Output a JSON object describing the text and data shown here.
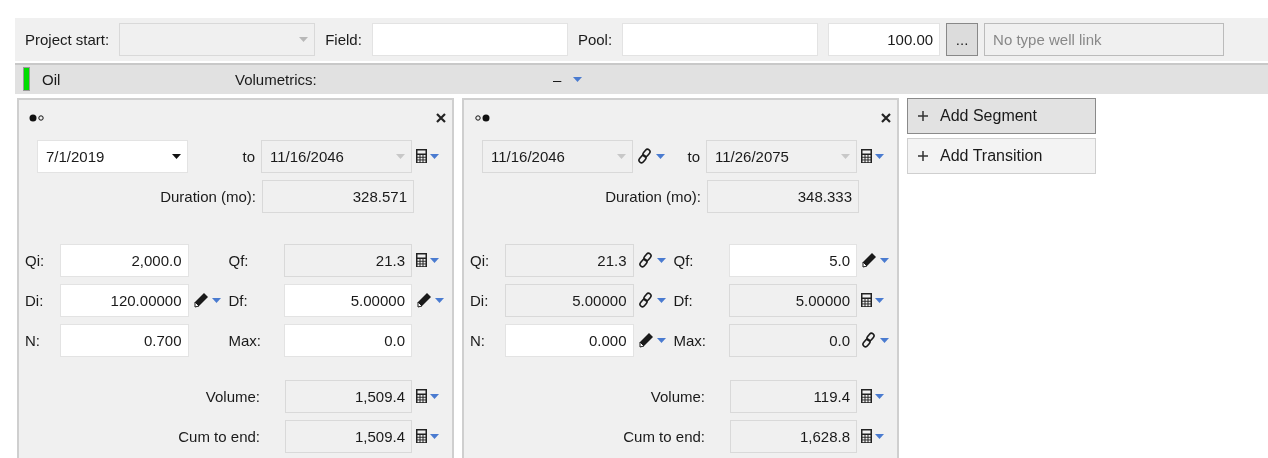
{
  "toolbar": [
    {
      "kind": "dropdown",
      "label": "Project start:",
      "disabled": true
    },
    {
      "kind": "text",
      "label": "Field:"
    },
    {
      "kind": "text",
      "label": "Pool:"
    },
    {
      "kind": "number",
      "value": "100.00"
    },
    {
      "kind": "browse",
      "label": "..."
    },
    {
      "kind": "readonly",
      "placeholder": "No type well link"
    }
  ],
  "stream": {
    "name": "Oil",
    "color": "#00dd00",
    "volumetrics_label": "Volumetrics:",
    "volumetrics_value": "–"
  },
  "segments": [
    {
      "dots": [
        {
          "selected": true
        },
        {
          "selected": false
        }
      ],
      "start": {
        "value": "7/1/2019",
        "editable": true
      },
      "to": "to",
      "end": {
        "value": "11/16/2046",
        "editable": false,
        "kind": "calc"
      },
      "duration": {
        "label": "Duration (mo):",
        "value": "328.571"
      },
      "params": [
        {
          "label": "Qi:",
          "value": "2,000.0",
          "editable": true
        },
        {
          "label": "Qf:",
          "value": "21.3",
          "editable": false,
          "kind": "calc"
        },
        {
          "label": "Di:",
          "value": "120.00000",
          "editable": true,
          "kind": "pencil"
        },
        {
          "label": "Df:",
          "value": "5.00000",
          "editable": true,
          "kind": "pencil"
        },
        {
          "label": "N:",
          "value": "0.700",
          "editable": true
        },
        {
          "label": "Max:",
          "value": "0.0",
          "editable": true
        }
      ],
      "results": [
        {
          "label": "Volume:",
          "value": "1,509.4",
          "kind": "calc"
        },
        {
          "label": "Cum to end:",
          "value": "1,509.4",
          "kind": "calc"
        }
      ]
    },
    {
      "dots": [
        {
          "selected": false
        },
        {
          "selected": true
        }
      ],
      "start": {
        "value": "11/16/2046",
        "editable": false,
        "kind": "link"
      },
      "to": "to",
      "end": {
        "value": "11/26/2075",
        "editable": false,
        "kind": "calc"
      },
      "duration": {
        "label": "Duration (mo):",
        "value": "348.333"
      },
      "params": [
        {
          "label": "Qi:",
          "value": "21.3",
          "editable": false,
          "kind": "link"
        },
        {
          "label": "Qf:",
          "value": "5.0",
          "editable": true,
          "kind": "pencil"
        },
        {
          "label": "Di:",
          "value": "5.00000",
          "editable": false,
          "kind": "link"
        },
        {
          "label": "Df:",
          "value": "5.00000",
          "editable": false,
          "kind": "calc"
        },
        {
          "label": "N:",
          "value": "0.000",
          "editable": true,
          "kind": "pencil"
        },
        {
          "label": "Max:",
          "value": "0.0",
          "editable": false,
          "kind": "link"
        }
      ],
      "results": [
        {
          "label": "Volume:",
          "value": "119.4",
          "kind": "calc"
        },
        {
          "label": "Cum to end:",
          "value": "1,628.8",
          "kind": "calc"
        }
      ]
    }
  ],
  "actions": [
    {
      "label": "Add Segment",
      "highlighted": true
    },
    {
      "label": "Add Transition",
      "highlighted": false
    }
  ]
}
